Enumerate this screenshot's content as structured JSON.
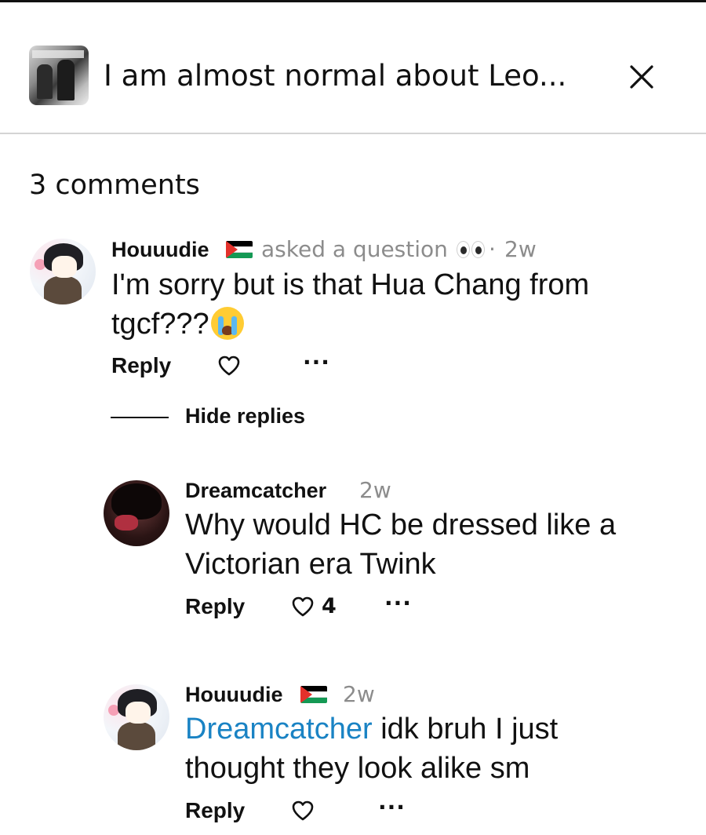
{
  "header": {
    "title": "I am almost normal about Leo...",
    "thumbnail_icon": "pin-thumbnail",
    "close_icon": "close-icon"
  },
  "comments_count_label": "3 comments",
  "comments": [
    {
      "username": "Houuudie",
      "flag": "🇵🇸",
      "action": "asked a question",
      "action_emoji": "👀",
      "separator": "·",
      "time": "2w",
      "text": "I'm sorry but is that Hua Chang from tgcf???",
      "text_emoji": "😭",
      "reply_label": "Reply",
      "likes": "",
      "more_label": "···"
    }
  ],
  "hide_replies_label": "Hide replies",
  "replies": [
    {
      "username": "Dreamcatcher",
      "time": "2w",
      "text_line1": "Why would HC be dressed like a",
      "text_line2": "Victorian era Twink",
      "reply_label": "Reply",
      "likes": "4",
      "more_label": "···"
    },
    {
      "username": "Houuudie",
      "flag": "🇵🇸",
      "time": "2w",
      "mention": "Dreamcatcher",
      "text_line1": "idk bruh I just",
      "text_line2": "thought they look alike sm",
      "reply_label": "Reply",
      "likes": "",
      "more_label": "···"
    }
  ]
}
